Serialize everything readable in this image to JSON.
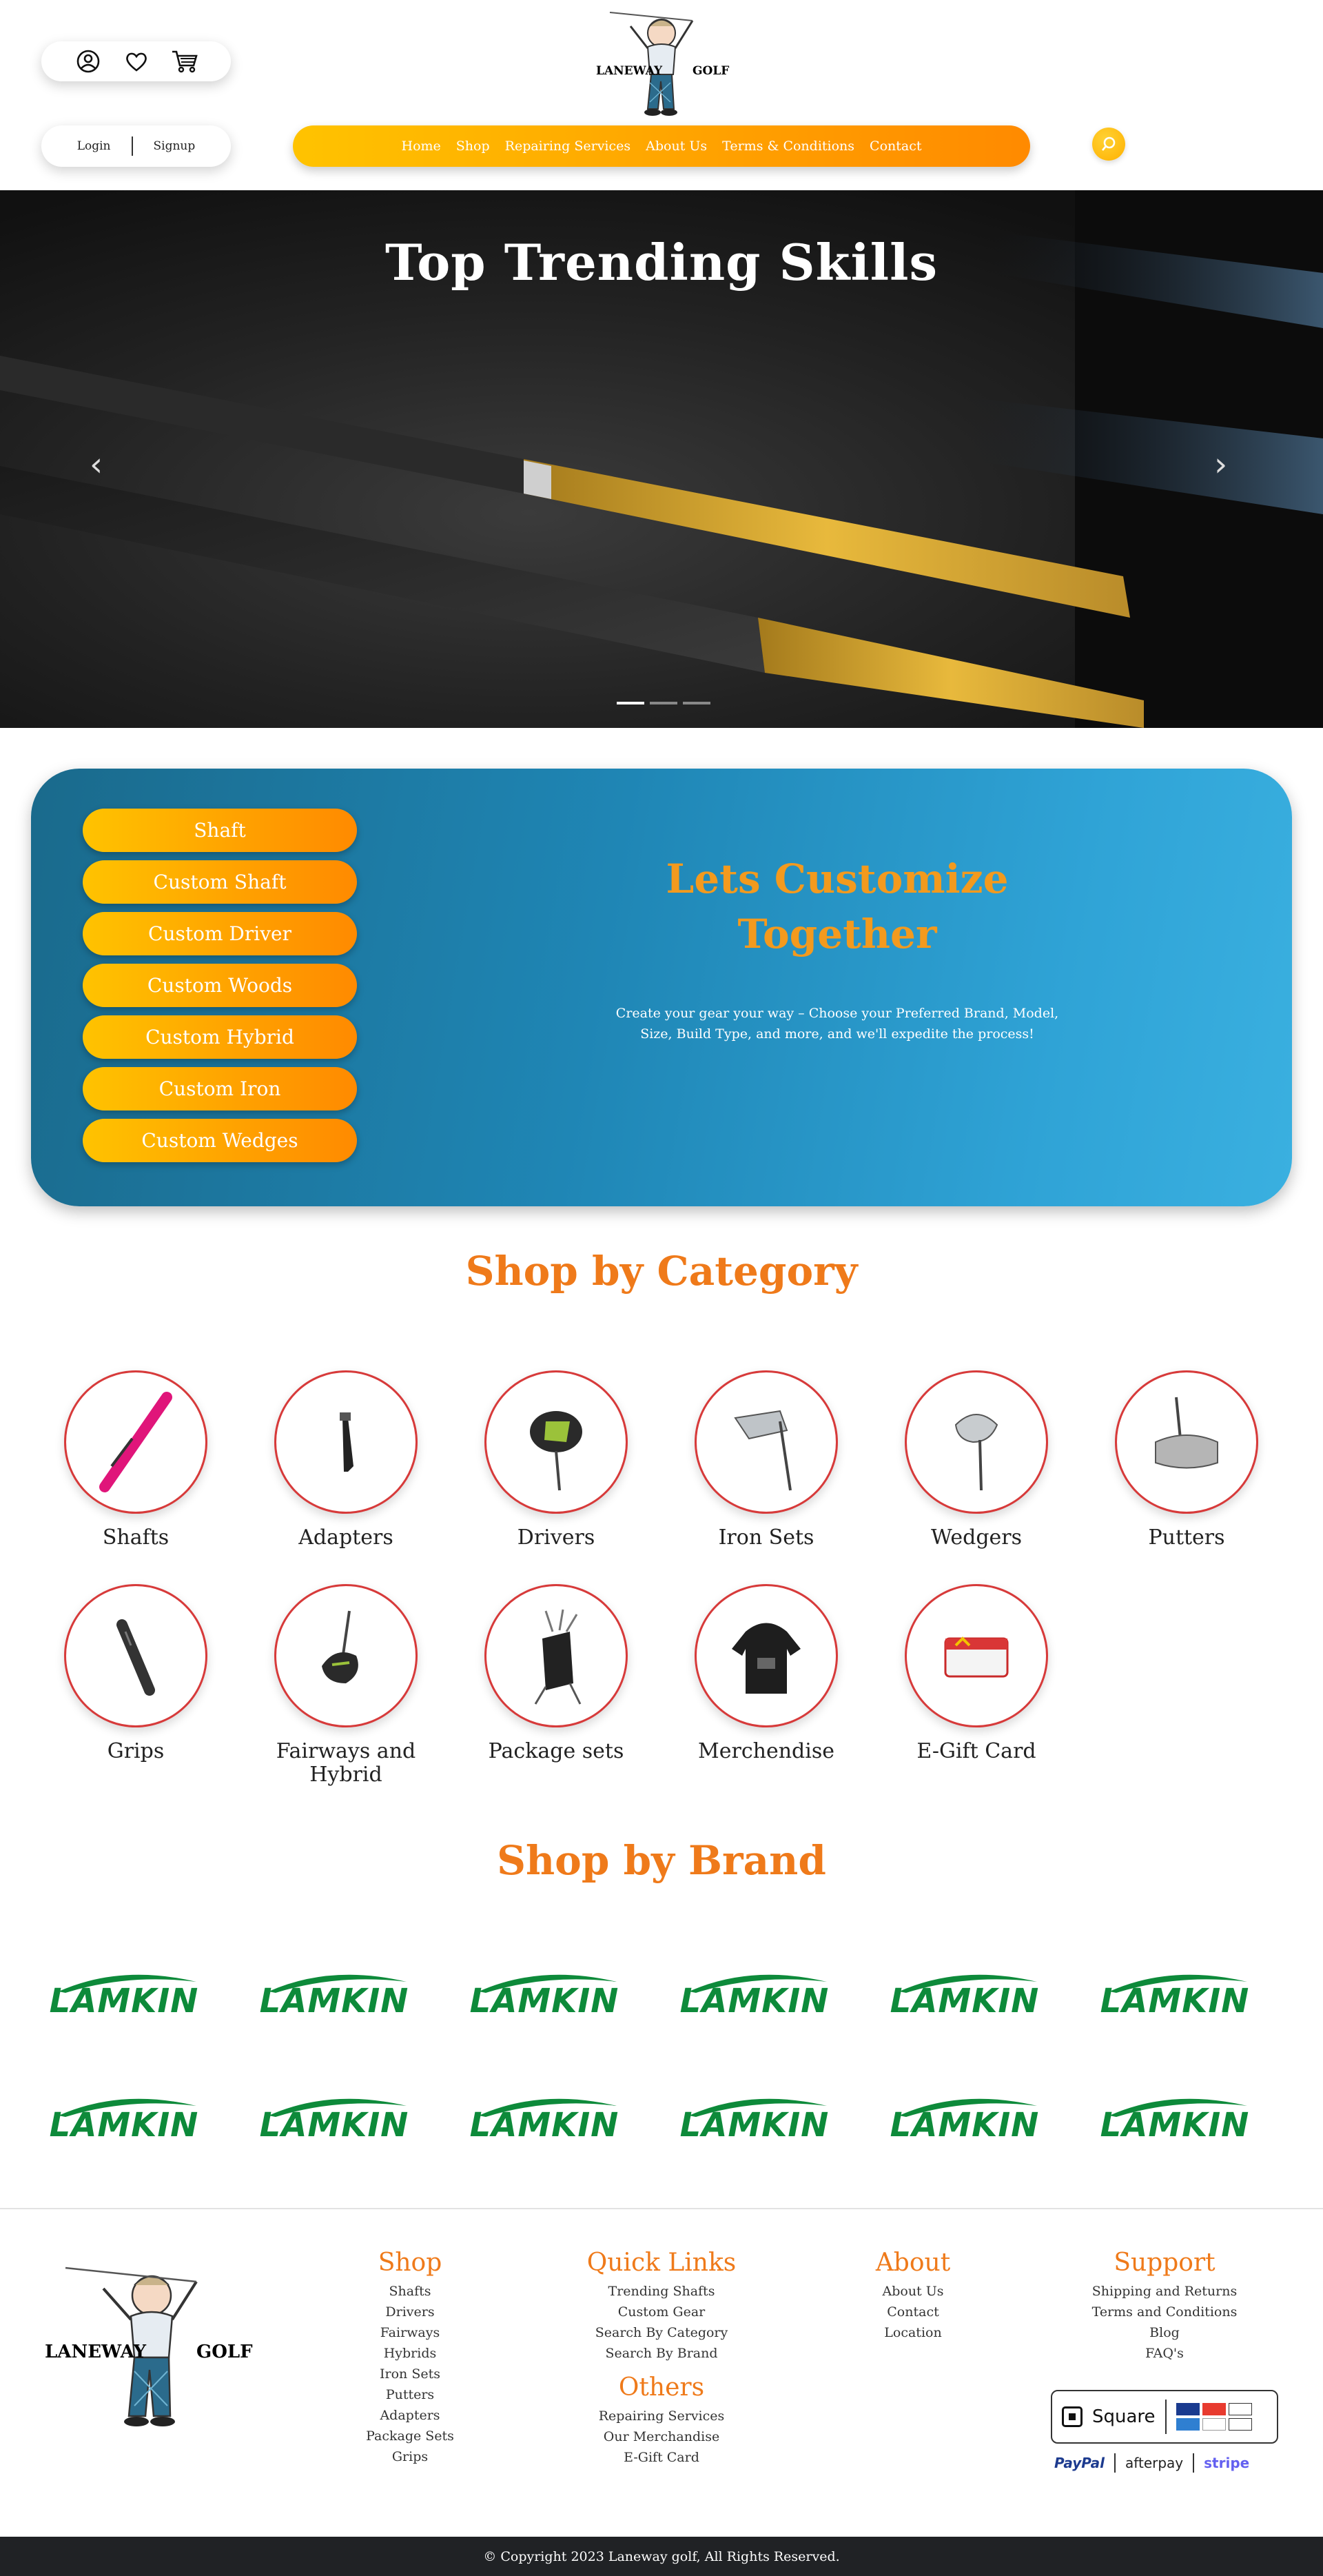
{
  "header": {
    "icons": [
      "user-icon",
      "heart-icon",
      "cart-icon"
    ],
    "login_label": "Login",
    "signup_label": "Signup",
    "logo_left": "LANEWAY",
    "logo_right": "GOLF",
    "search_icon": "search-icon"
  },
  "nav": {
    "items": [
      "Home",
      "Shop",
      "Repairing Services",
      "About Us",
      "Terms & Conditions",
      "Contact"
    ],
    "gradient": [
      "#ffc300",
      "#ff8a00"
    ]
  },
  "hero": {
    "title": "Top Trending Skills",
    "prev_icon": "‹",
    "next_icon": "›",
    "slide_count": 3,
    "active_slide": 1
  },
  "customize": {
    "buttons": [
      "Shaft",
      "Custom Shaft",
      "Custom Driver",
      "Custom Woods",
      "Custom Hybrid",
      "Custom Iron",
      "Custom Wedges"
    ],
    "title_line1": "Lets Customize",
    "title_line2": "Together",
    "subtitle_line1": "Create your gear your way – Choose your Preferred Brand, Model,",
    "subtitle_line2": "Size, Build Type, and more, and we'll expedite the process!"
  },
  "categories": {
    "title": "Shop by Category",
    "items": [
      "Shafts",
      "Adapters",
      "Drivers",
      "Iron Sets",
      "Wedgers",
      "Putters",
      "Grips",
      "Fairways and Hybrid",
      "Package sets",
      "Merchendise",
      "E-Gift Card"
    ]
  },
  "brands": {
    "title": "Shop by Brand",
    "items": [
      "LAMKIN",
      "LAMKIN",
      "LAMKIN",
      "LAMKIN",
      "LAMKIN",
      "LAMKIN",
      "LAMKIN",
      "LAMKIN",
      "LAMKIN",
      "LAMKIN",
      "LAMKIN",
      "LAMKIN"
    ],
    "color": "#0d8a3a"
  },
  "footer": {
    "logo_left": "LANEWAY",
    "logo_right": "GOLF",
    "shop": {
      "title": "Shop",
      "links": [
        "Shafts",
        "Drivers",
        "Fairways",
        "Hybrids",
        "Iron Sets",
        "Putters",
        "Adapters",
        "Package Sets",
        "Grips"
      ]
    },
    "quick_links": {
      "title": "Quick Links",
      "links": [
        "Trending Shafts",
        "Custom Gear",
        "Search By Category",
        "Search By Brand"
      ]
    },
    "others": {
      "title": "Others",
      "links": [
        "Repairing Services",
        "Our Merchandise",
        "E-Gift Card"
      ]
    },
    "about": {
      "title": "About",
      "links": [
        "About Us",
        "Contact",
        "Location"
      ]
    },
    "support": {
      "title": "Support",
      "links": [
        "Shipping and Returns",
        "Terms and Conditions",
        "Blog",
        "FAQ's"
      ]
    },
    "payments": {
      "square": "Square",
      "paypal": "PayPal",
      "afterpay": "afterpay",
      "stripe": "stripe"
    },
    "copyright": "© Copyright 2023 Laneway golf, All Rights Reserved."
  }
}
